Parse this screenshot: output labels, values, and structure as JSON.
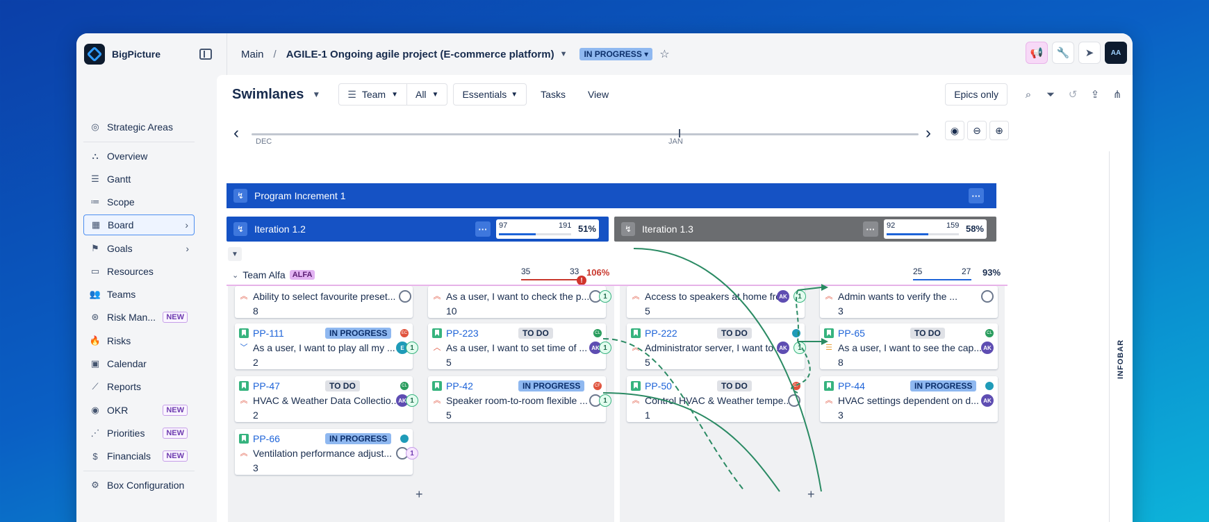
{
  "app": {
    "name": "BigPicture"
  },
  "breadcrumb": {
    "root": "Main",
    "project": "AGILE-1 Ongoing agile project (E-commerce platform)",
    "status": "IN PROGRESS"
  },
  "sidebar": {
    "items": [
      {
        "label": "Strategic Areas",
        "icon": "target-icon"
      },
      {
        "label": "Overview",
        "icon": "hierarchy-icon"
      },
      {
        "label": "Gantt",
        "icon": "gantt-icon"
      },
      {
        "label": "Scope",
        "icon": "list-icon"
      },
      {
        "label": "Board",
        "icon": "board-icon"
      },
      {
        "label": "Goals",
        "icon": "goals-icon"
      },
      {
        "label": "Resources",
        "icon": "resources-icon"
      },
      {
        "label": "Teams",
        "icon": "teams-icon"
      },
      {
        "label": "Risk Man...",
        "icon": "risk-icon",
        "badge": "NEW"
      },
      {
        "label": "Risks",
        "icon": "fire-icon"
      },
      {
        "label": "Calendar",
        "icon": "calendar-icon"
      },
      {
        "label": "Reports",
        "icon": "chart-icon"
      },
      {
        "label": "OKR",
        "icon": "okr-icon",
        "badge": "NEW"
      },
      {
        "label": "Priorities",
        "icon": "priorities-icon",
        "badge": "NEW"
      },
      {
        "label": "Financials",
        "icon": "dollar-icon",
        "badge": "NEW"
      },
      {
        "label": "Box Configuration",
        "icon": "gear-icon"
      }
    ]
  },
  "toolbar": {
    "view_title": "Swimlanes",
    "team": "Team",
    "all": "All",
    "essentials": "Essentials",
    "tasks": "Tasks",
    "view": "View",
    "epics_only": "Epics only"
  },
  "timeline": {
    "left": "DEC",
    "right": "JAN"
  },
  "program_increment": {
    "label": "Program Increment 1",
    "dots": "···"
  },
  "iterations": [
    {
      "label": "Iteration 1.2",
      "done": "97",
      "total": "191",
      "pct": "51%",
      "progress": 0.51,
      "color": "#1552c4"
    },
    {
      "label": "Iteration 1.3",
      "done": "92",
      "total": "159",
      "pct": "58%",
      "progress": 0.58,
      "color": "#6b6d70"
    }
  ],
  "team": {
    "name": "Team Alfa",
    "tag": "ALFA",
    "load1": {
      "a": "35",
      "b": "33",
      "pct": "106%",
      "warn": "!"
    },
    "load2": {
      "a": "25",
      "b": "27",
      "pct": "93%"
    }
  },
  "cards": {
    "c1": {
      "summary": "Ability to select favourite preset...",
      "points": "8",
      "avatar": ""
    },
    "c2": {
      "summary": "As a user, I want to check the p...",
      "points": "10",
      "link": "1"
    },
    "c3": {
      "summary": "Access to speakers at home fro...",
      "points": "5",
      "avatar": "AK",
      "link": "1"
    },
    "c4": {
      "summary": "Admin wants to verify the ...",
      "points": "3"
    },
    "c5": {
      "key": "PP-111",
      "status": "IN PROGRESS",
      "summary": "As a user, I want to play all my ...",
      "points": "2",
      "avatar": "E",
      "link": "1",
      "mini": "EC"
    },
    "c6": {
      "key": "PP-223",
      "status": "TO DO",
      "summary": "As a user, I want to set time of ...",
      "points": "5",
      "avatar": "AK",
      "link": "1",
      "mini": "CL"
    },
    "c7": {
      "key": "PP-222",
      "status": "TO DO",
      "summary": "Administrator server, I want to ...",
      "points": "5",
      "avatar": "AK",
      "link": "1"
    },
    "c8": {
      "key": "PP-65",
      "status": "TO DO",
      "summary": "As a user, I want to see the cap...",
      "points": "8",
      "avatar": "AK",
      "mini": "CL"
    },
    "c9": {
      "key": "PP-47",
      "status": "TO DO",
      "summary": "HVAC & Weather Data Collectio...",
      "points": "2",
      "avatar": "AK",
      "link": "1",
      "mini": "CL"
    },
    "c10": {
      "key": "PP-42",
      "status": "IN PROGRESS",
      "summary": "Speaker room-to-room flexible ...",
      "points": "5",
      "link": "1",
      "mini": "CF"
    },
    "c11": {
      "key": "PP-50",
      "status": "TO DO",
      "summary": "Control HVAC & Weather tempe...",
      "points": "1",
      "mini": "CF"
    },
    "c12": {
      "key": "PP-44",
      "status": "IN PROGRESS",
      "summary": "HVAC settings dependent on d...",
      "points": "3",
      "avatar": "AK"
    },
    "c13": {
      "key": "PP-66",
      "status": "IN PROGRESS",
      "summary": "Ventilation performance adjust...",
      "points": "3",
      "link": "1"
    }
  },
  "add_symbol": "+",
  "infobar": "INFOBAR"
}
